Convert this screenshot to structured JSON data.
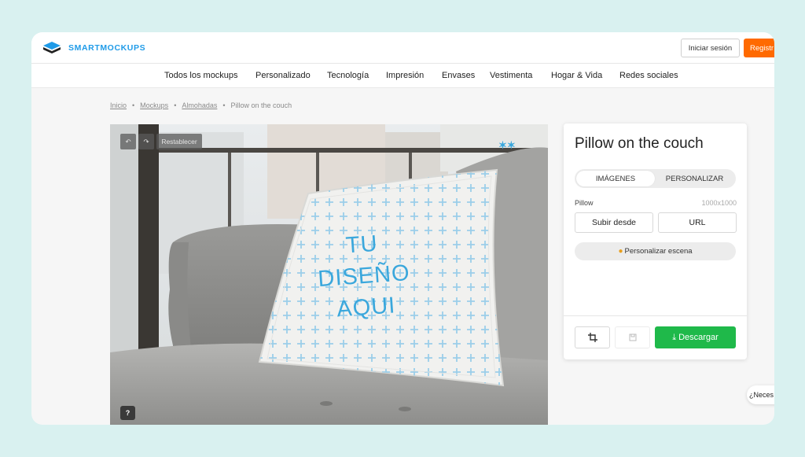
{
  "header": {
    "brand": "SMARTMOCKUPS",
    "login_label": "Iniciar sesión",
    "register_label": "Registr"
  },
  "nav": {
    "items": [
      "Todos los mockups",
      "Personalizado",
      "Tecnología",
      "Impresión",
      "Envases",
      "Vestimenta",
      "Hogar & Vida",
      "Redes sociales"
    ]
  },
  "breadcrumb": {
    "items": [
      "Inicio",
      "Mockups",
      "Almohadas"
    ],
    "current": "Pillow on the couch",
    "separator": "•"
  },
  "canvas": {
    "undo_icon": "undo-icon",
    "redo_icon": "redo-icon",
    "reset_label": "Restablecer",
    "pillow_text": [
      "TU",
      "DISEÑO",
      "AQUI"
    ],
    "help_label": "?"
  },
  "panel": {
    "title": "Pillow on the couch",
    "tabs": [
      "IMÁGENES",
      "PERSONALIZAR"
    ],
    "layer_name": "Pillow",
    "layer_size": "1000x1000",
    "upload_from_label": "Subir desde",
    "url_label": "URL",
    "customize_scene_label": "Personalizar escena",
    "download_label": "Descargar"
  },
  "help_chat": {
    "label": "¿Neces"
  },
  "colors": {
    "background": "#d9f1f0",
    "brand": "#1f9be8",
    "register": "#ff6a00",
    "download": "#1fb94a",
    "pillow_pattern": "#3aa7dc"
  }
}
